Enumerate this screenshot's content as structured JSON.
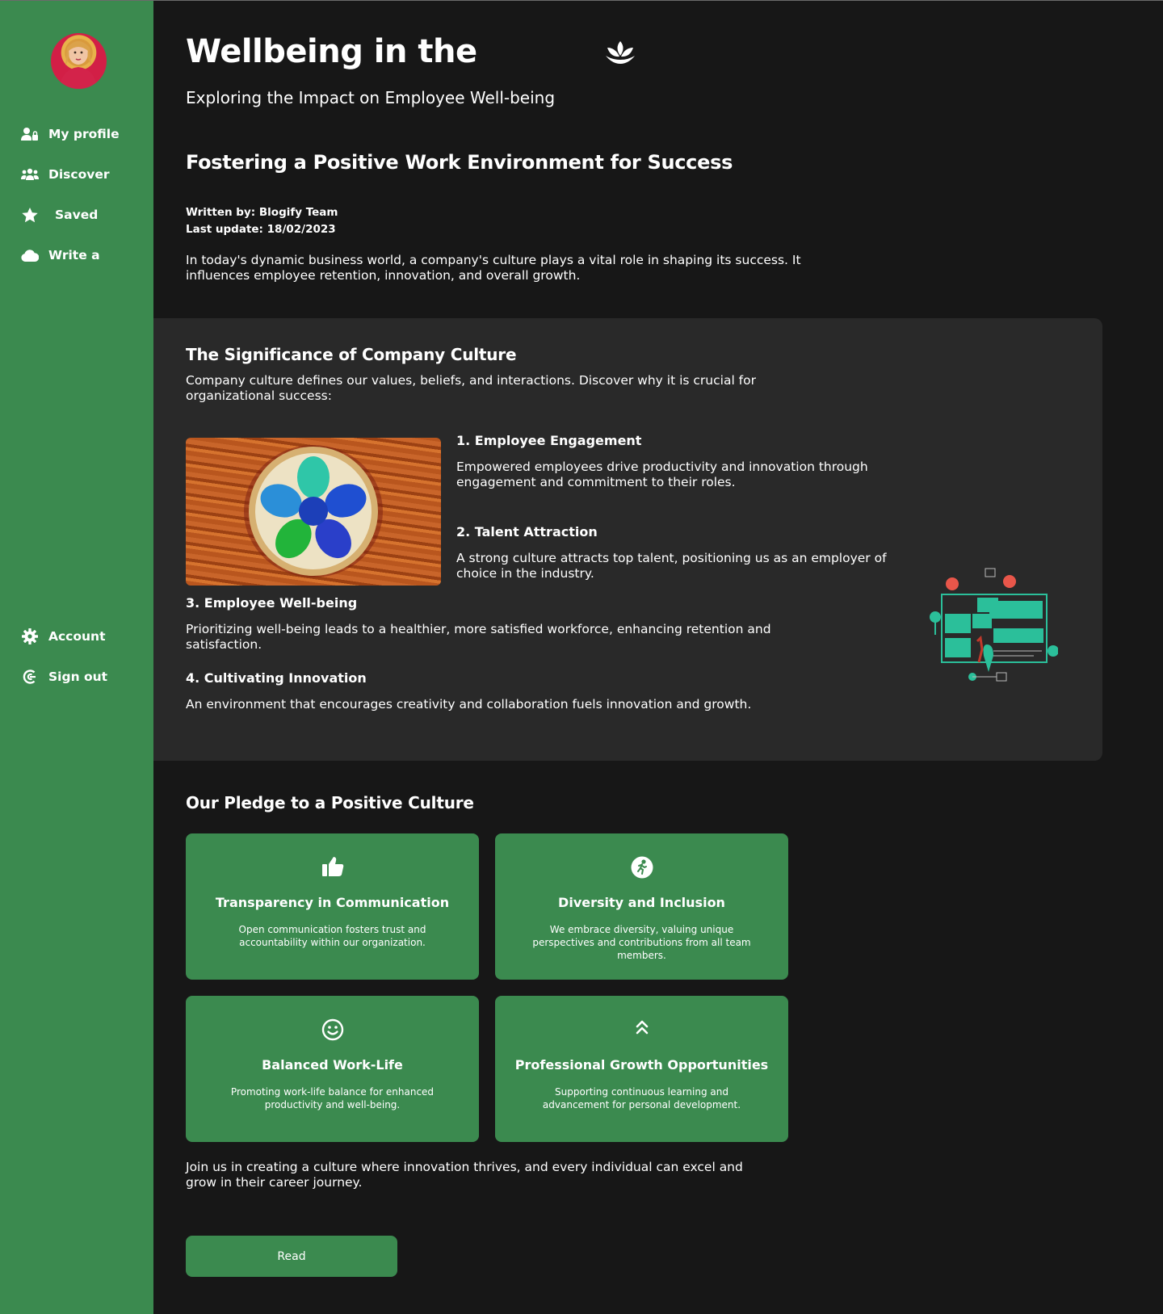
{
  "sidebar": {
    "items": [
      {
        "label": "My profile",
        "icon": "user-lock-icon"
      },
      {
        "label": "Discover",
        "icon": "users-icon"
      },
      {
        "label": "Saved",
        "icon": "star-icon"
      },
      {
        "label": "Write a",
        "icon": "cloud-icon"
      }
    ],
    "bottom_items": [
      {
        "label": "Account",
        "icon": "gear-icon"
      },
      {
        "label": "Sign out",
        "icon": "sign-out-icon"
      }
    ]
  },
  "header": {
    "title": "Wellbeing in the",
    "subtitle": "Exploring the Impact on Employee Well-being"
  },
  "article": {
    "heading": "Fostering a Positive Work Environment for Success",
    "written_by": "Written by: Blogify Team",
    "last_update": "Last update: 18/02/2023",
    "intro": "In today's dynamic business world, a company's culture plays a vital role in shaping its success. It influences employee retention, innovation, and overall growth."
  },
  "culture": {
    "title": "The Significance of Company Culture",
    "description": "Company culture defines our values, beliefs, and interactions. Discover why it is crucial for organizational success:",
    "items": [
      {
        "title": "1. Employee Engagement",
        "text": "Empowered employees drive productivity and innovation through engagement and commitment to their roles."
      },
      {
        "title": "2. Talent Attraction",
        "text": "A strong culture attracts top talent, positioning us as an employer of choice in the industry."
      },
      {
        "title": "3. Employee Well-being",
        "text": "Prioritizing well-being leads to a healthier, more satisfied workforce, enhancing retention and satisfaction."
      },
      {
        "title": "4. Cultivating Innovation",
        "text": "An environment that encourages creativity and collaboration fuels innovation and growth."
      }
    ]
  },
  "pledge": {
    "title": "Our Pledge to a Positive Culture",
    "cards": [
      {
        "title": "Transparency in Communication",
        "text": "Open communication fosters trust and accountability within our organization.",
        "icon": "thumbs-up-icon"
      },
      {
        "title": "Diversity and Inclusion",
        "text": "We embrace diversity, valuing unique perspectives and contributions from all team members.",
        "icon": "person-running-icon"
      },
      {
        "title": "Balanced Work-Life",
        "text": "Promoting work-life balance for enhanced productivity and well-being.",
        "icon": "smile-icon"
      },
      {
        "title": "Professional Growth Opportunities",
        "text": "Supporting continuous learning and advancement for personal development.",
        "icon": "double-chevron-up-icon"
      }
    ],
    "closing": "Join us in creating a culture where innovation thrives, and every individual can excel and grow in their career journey."
  },
  "read_button": "Read",
  "colors": {
    "accent": "#3b8a4f",
    "background": "#171717",
    "panel": "#292929"
  }
}
